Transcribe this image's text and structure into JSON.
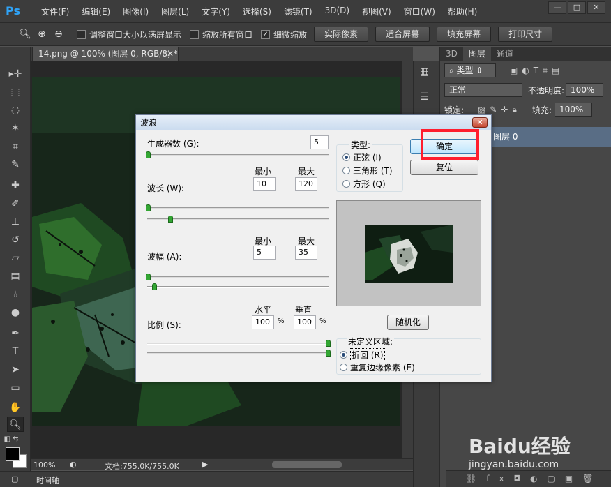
{
  "app": {
    "logo": "Ps",
    "menu": [
      "文件(F)",
      "编辑(E)",
      "图像(I)",
      "图层(L)",
      "文字(Y)",
      "选择(S)",
      "滤镜(T)",
      "3D(D)",
      "视图(V)",
      "窗口(W)",
      "帮助(H)"
    ],
    "window_controls": [
      "—",
      "□",
      "✕"
    ]
  },
  "options_bar": {
    "checks": [
      {
        "label": "调整窗口大小以满屏显示",
        "checked": false
      },
      {
        "label": "缩放所有窗口",
        "checked": false
      },
      {
        "label": "细微缩放",
        "checked": true
      }
    ],
    "buttons": [
      "实际像素",
      "适合屏幕",
      "填充屏幕",
      "打印尺寸"
    ]
  },
  "document": {
    "tab_title": "14.png @ 100% (图层 0, RGB/8) *",
    "zoom": "100%",
    "doc_info": "文档:755.0K/755.0K",
    "timeline_label": "时间轴"
  },
  "layers_panel": {
    "tabs": [
      "3D",
      "图层",
      "通道"
    ],
    "filter_kind": "类型",
    "blend_mode": "正常",
    "opacity_label": "不透明度:",
    "opacity_value": "100%",
    "lock_label": "锁定:",
    "fill_label": "填充:",
    "fill_value": "100%",
    "layer_name": "图层 0"
  },
  "dialog": {
    "title": "波浪",
    "generators_label": "生成器数 (G):",
    "generators_value": "5",
    "min_label": "最小",
    "max_label": "最大",
    "wavelength_label": "波长 (W):",
    "wavelength_min": "10",
    "wavelength_max": "120",
    "amplitude_label": "波幅 (A):",
    "amplitude_min": "5",
    "amplitude_max": "35",
    "scale_label": "比例 (S):",
    "horizontal_label": "水平",
    "vertical_label": "垂直",
    "scale_h": "100",
    "scale_v": "100",
    "percent": "%",
    "type_label": "类型:",
    "type_options": [
      "正弦 (I)",
      "三角形 (T)",
      "方形 (Q)"
    ],
    "type_selected": 0,
    "ok_button": "确定",
    "reset_button": "复位",
    "randomize_button": "随机化",
    "undefined_area_label": "未定义区域:",
    "undefined_options": [
      "折回 (R)",
      "重复边缘像素 (E)"
    ],
    "undefined_selected": 0
  },
  "watermark": {
    "logo": "Baidu经验",
    "url": "jingyan.baidu.com"
  }
}
